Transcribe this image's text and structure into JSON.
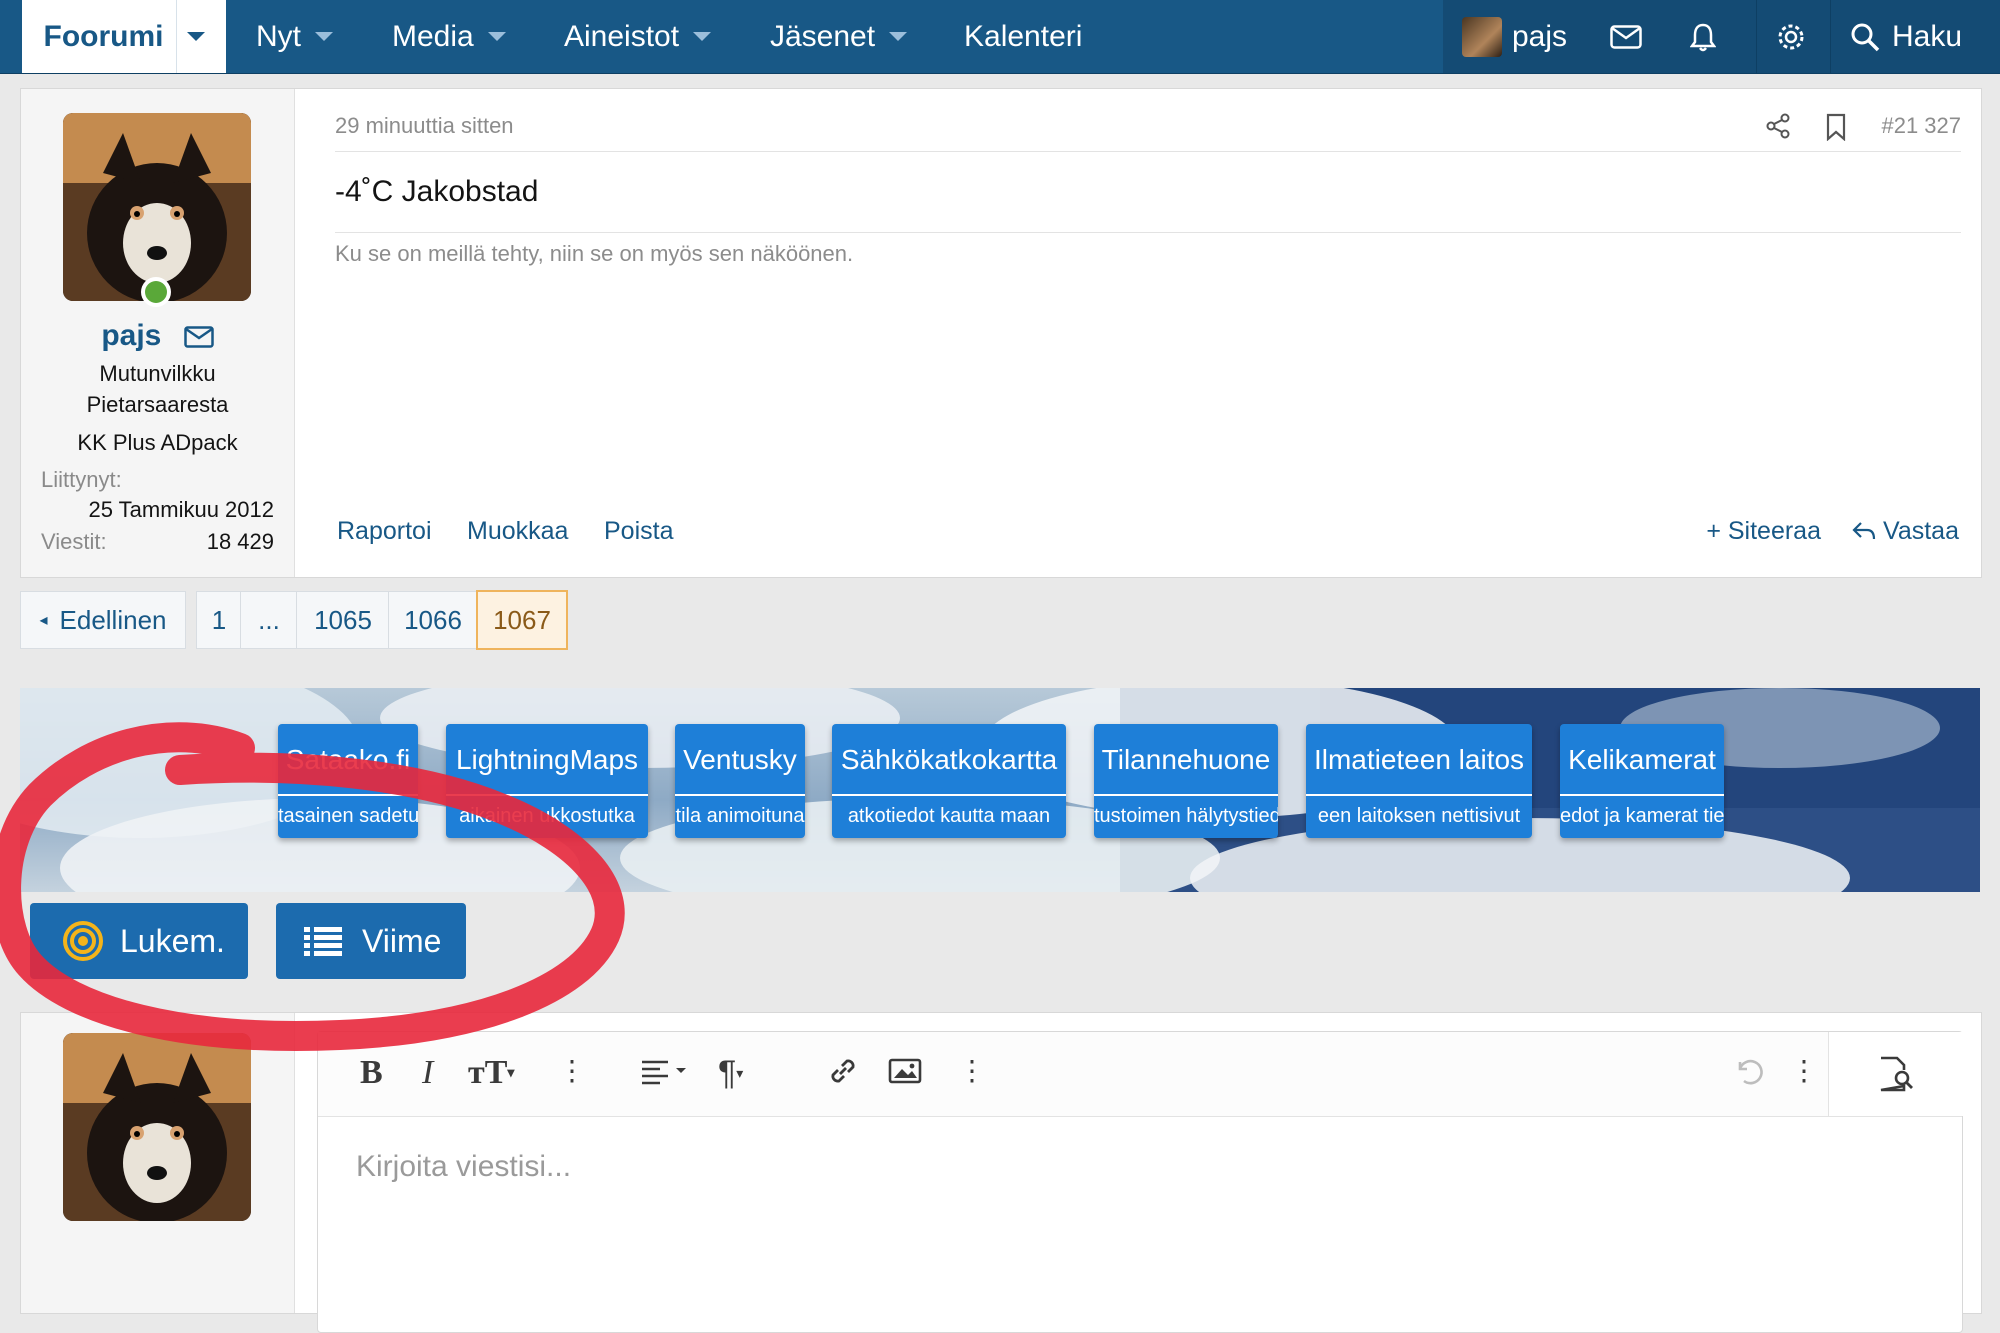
{
  "nav": {
    "forum": "Foorumi",
    "items": [
      "Nyt",
      "Media",
      "Aineistot",
      "Jäsenet",
      "Kalenteri"
    ],
    "username": "pajs",
    "search": "Haku"
  },
  "post": {
    "author": "pajs",
    "title_line1": "Mutunvilkku",
    "title_line2": "Pietarsaaresta",
    "banner": "KK Plus ADpack",
    "joined_label": "Liittynyt:",
    "joined_value": "25 Tammikuu 2012",
    "posts_label": "Viestit:",
    "posts_value": "18 429",
    "date": "29 minuuttia sitten",
    "number": "#21 327",
    "content": "-4˚C Jakobstad",
    "signature": "Ku se on meillä tehty, niin se on myös sen näköönen.",
    "actions": {
      "report": "Raportoi",
      "edit": "Muokkaa",
      "delete": "Poista",
      "quote": "Siteeraa",
      "reply": "Vastaa"
    }
  },
  "pagination": {
    "prev": "Edellinen",
    "pages": [
      "1",
      "...",
      "1065",
      "1066",
      "1067"
    ],
    "current": "1067"
  },
  "quick_links": [
    {
      "title": "Sataako.fi",
      "desc": "tasainen sadetu"
    },
    {
      "title": "LightningMaps",
      "desc": "aikainen ukkostutka"
    },
    {
      "title": "Ventusky",
      "desc": "tila animoituna"
    },
    {
      "title": "Sähkökatkokartta",
      "desc": "atkotiedot kautta maan"
    },
    {
      "title": "Tilannehuone",
      "desc": "tustoimen hälytystied"
    },
    {
      "title": "Ilmatieteen laitos",
      "desc": "een laitoksen nettisivut"
    },
    {
      "title": "Kelikamerat",
      "desc": "edot ja kamerat tie"
    }
  ],
  "buttons": {
    "unread": "Lukem.",
    "recent": "Viime"
  },
  "editor": {
    "placeholder": "Kirjoita viestisi..."
  },
  "colors": {
    "nav": "#185886",
    "link": "#185886",
    "quick_link": "#1e7fd8",
    "button": "#1c6bae",
    "annotation": "#e8283c"
  }
}
